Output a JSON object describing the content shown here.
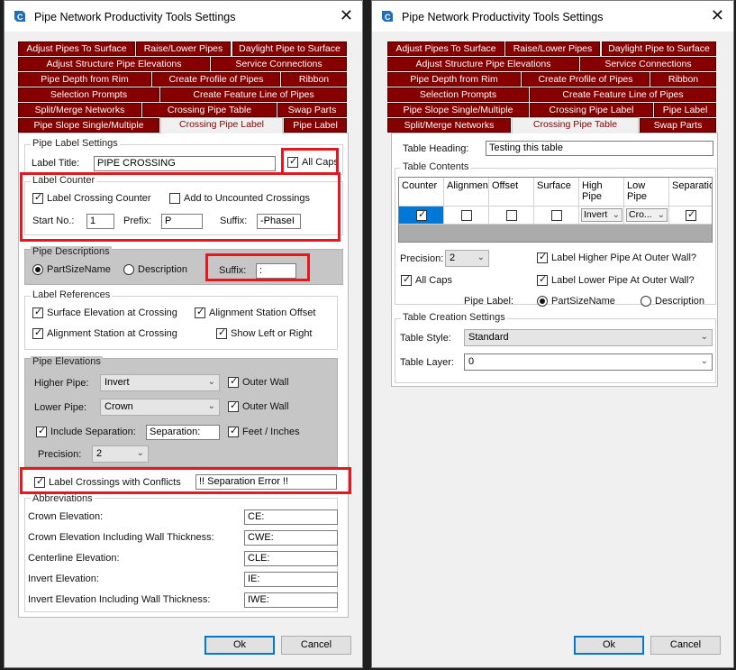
{
  "left_window": {
    "title": "Pipe Network Productivity Tools Settings",
    "tabs": [
      "Adjust Pipes To Surface",
      "Raise/Lower Pipes",
      "Daylight Pipe to Surface",
      "Adjust Structure Pipe Elevations",
      "Service Connections",
      "Pipe Depth from Rim",
      "Create Profile of Pipes",
      "Ribbon",
      "Selection Prompts",
      "Create Feature Line of Pipes",
      "Split/Merge Networks",
      "Crossing Pipe Table",
      "Swap Parts",
      "Pipe Slope Single/Multiple",
      "Crossing Pipe Label",
      "Pipe Label"
    ],
    "pipe_label_settings": {
      "group_title": "Pipe Label Settings",
      "label_title_label": "Label Title:",
      "label_title_value": "PIPE CROSSING",
      "all_caps_label": "All Caps"
    },
    "label_counter": {
      "group_title": "Label Counter",
      "label_crossing_counter": "Label Crossing Counter",
      "add_to_uncounted": "Add to Uncounted Crossings",
      "start_no_label": "Start No.:",
      "start_no_value": "1",
      "prefix_label": "Prefix:",
      "prefix_value": "P",
      "suffix_label": "Suffix:",
      "suffix_value": "-PhaseI"
    },
    "pipe_descriptions": {
      "group_title": "Pipe Descriptions",
      "partsizename": "PartSizeName",
      "description": "Description",
      "suffix_label": "Suffix:",
      "suffix_value": ":"
    },
    "label_references": {
      "group_title": "Label References",
      "surface_elevation": "Surface Elevation at Crossing",
      "alignment_station_offset": "Alignment Station Offset",
      "alignment_station": "Alignment Station at Crossing",
      "show_left_right": "Show Left or Right"
    },
    "pipe_elevations": {
      "group_title": "Pipe Elevations",
      "higher_pipe_label": "Higher Pipe:",
      "higher_pipe_value": "Invert",
      "lower_pipe_label": "Lower Pipe:",
      "lower_pipe_value": "Crown",
      "outer_wall": "Outer Wall",
      "include_separation": "Include Separation:",
      "separation_value": "Separation:",
      "feet_inches": "Feet / Inches",
      "precision_label": "Precision:",
      "precision_value": "2"
    },
    "conflicts": {
      "label": "Label Crossings with Conflicts",
      "value": "!! Separation Error !!"
    },
    "abbreviations": {
      "group_title": "Abbreviations",
      "rows": [
        {
          "label": "Crown Elevation:",
          "value": "CE:"
        },
        {
          "label": "Crown Elevation Including Wall Thickness:",
          "value": "CWE:"
        },
        {
          "label": "Centerline Elevation:",
          "value": "CLE:"
        },
        {
          "label": "Invert Elevation:",
          "value": "IE:"
        },
        {
          "label": "Invert Elevation Including Wall Thickness:",
          "value": "IWE:"
        }
      ]
    },
    "ok_label": "Ok",
    "cancel_label": "Cancel"
  },
  "right_window": {
    "title": "Pipe Network Productivity Tools Settings",
    "tabs": [
      "Adjust Pipes To Surface",
      "Raise/Lower Pipes",
      "Daylight Pipe to Surface",
      "Adjust Structure Pipe Elevations",
      "Service Connections",
      "Pipe Depth from Rim",
      "Create Profile of Pipes",
      "Ribbon",
      "Selection Prompts",
      "Create Feature Line of Pipes",
      "Pipe Slope Single/Multiple",
      "Crossing Pipe Label",
      "Pipe Label",
      "Split/Merge Networks",
      "Crossing Pipe Table",
      "Swap Parts"
    ],
    "table_heading_label": "Table Heading:",
    "table_heading_value": "Testing this table",
    "table_contents": {
      "group_title": "Table Contents",
      "columns": [
        "Counter",
        "Alignment",
        "Offset",
        "Surface",
        "High Pipe",
        "Low Pipe",
        "Separation"
      ],
      "row": {
        "high_pipe": "Invert",
        "low_pipe": "Cro..."
      }
    },
    "precision_label": "Precision:",
    "precision_value": "2",
    "all_caps": "All Caps",
    "label_higher": "Label Higher Pipe At Outer Wall?",
    "label_lower": "Label Lower Pipe At Outer Wall?",
    "pipe_label_label": "Pipe Label:",
    "partsizename": "PartSizeName",
    "description": "Description",
    "table_creation": {
      "group_title": "Table Creation Settings",
      "style_label": "Table Style:",
      "style_value": "Standard",
      "layer_label": "Table Layer:",
      "layer_value": "0"
    },
    "ok_label": "Ok",
    "cancel_label": "Cancel"
  },
  "colors": {
    "tab_background": "#860000",
    "highlight_border": "#e3191f",
    "selection_blue": "#0078d7"
  }
}
